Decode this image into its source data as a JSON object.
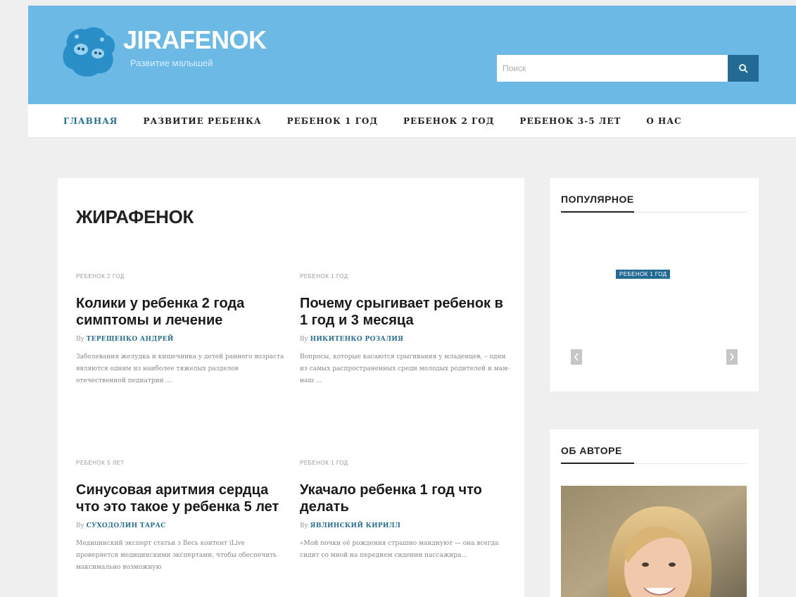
{
  "header": {
    "logo_title": "JIRAFENOK",
    "logo_subtitle": "Развитие малышей",
    "search_placeholder": "Поиск"
  },
  "nav": {
    "items": [
      "ГЛАВНАЯ",
      "РАЗВИТИЕ РЕБЕНКА",
      "РЕБЕНОК 1 ГОД",
      "РЕБЕНОК 2 ГОД",
      "РЕБЕНОК 3-5 ЛЕТ",
      "О НАС"
    ]
  },
  "main": {
    "title": "ЖИРАФЕНОК",
    "posts": [
      {
        "category": "РЕБЕНОК 2 ГОД",
        "title": "Колики у ребенка 2 года симптомы и лечение",
        "by": "By",
        "author": "ТЕРЕЩЕНКО АНДРЕЙ",
        "excerpt": "Заболевания желудка и кишечника у детей раннего возраста являются одним из наиболее тяжелых разделов отечественной педиатрии ..."
      },
      {
        "category": "РЕБЕНОК 1 ГОД",
        "title": "Почему срыгивает ребенок в 1 год и 3 месяца",
        "by": "By",
        "author": "НИКИТЕНКО РОЗАЛИЯ",
        "excerpt": "Вопросы, которые касаются срыгивания у младенцев, – одни из самых распространенных среди молодых родителей и мам-наш ..."
      },
      {
        "category": "РЕБЕНОК 5 ЛЕТ",
        "title": "Синусовая аритмия сердца что это такое у ребенка 5 лет",
        "by": "By",
        "author": "СУХОДОЛИН ТАРАС",
        "excerpt": "Медицинский эксперт статьи з Весь контент iLive проверяется медицинскими экспертами, чтобы обеспечить максимально возможную"
      },
      {
        "category": "РЕБЕНОК 1 ГОД",
        "title": "Укачало ребенка 1 год что делать",
        "by": "By",
        "author": "ЯВЛИНСКИЙ КИРИЛЛ",
        "excerpt": "«Мой почки её рождения страшно мандиуют — она всегда сидит со мной на переднем сидении пассажира..."
      }
    ]
  },
  "sidebar": {
    "popular": {
      "title": "ПОПУЛЯРНОЕ",
      "badge": "РЕБЕНОК 1 ГОД"
    },
    "author": {
      "title": "ОБ АВТОРЕ"
    }
  },
  "colors": {
    "header_bg": "#6cb9e6",
    "accent": "#236a94",
    "nav_active": "#2b6f8e",
    "page_bg": "#efefef"
  }
}
